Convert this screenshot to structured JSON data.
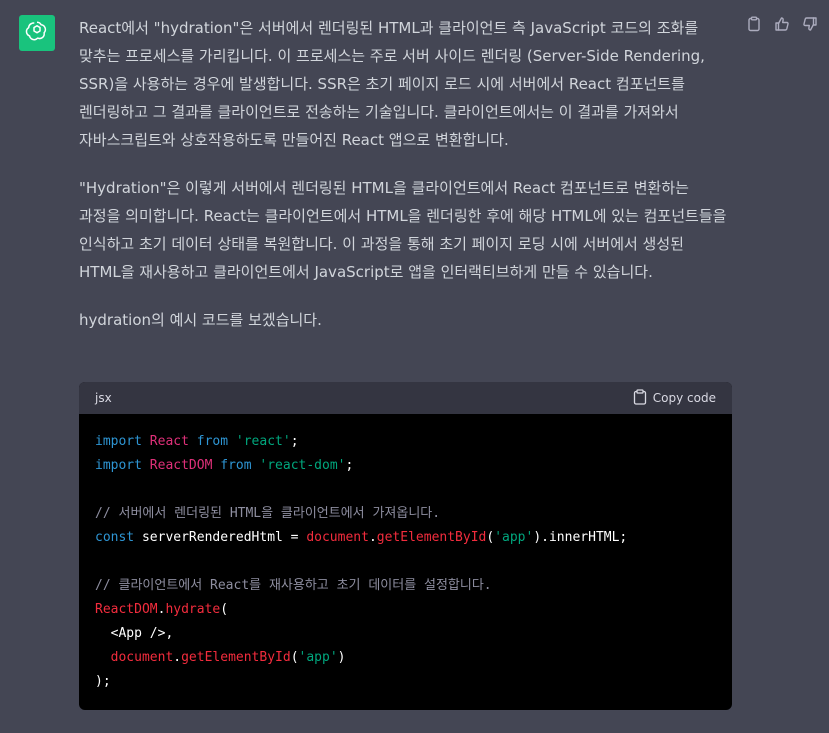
{
  "message": {
    "paragraphs": [
      "React에서 \"hydration\"은 서버에서 렌더링된 HTML과 클라이언트 측 JavaScript 코드의 조화를 맞추는 프로세스를 가리킵니다. 이 프로세스는 주로 서버 사이드 렌더링 (Server-Side Rendering, SSR)을 사용하는 경우에 발생합니다. SSR은 초기 페이지 로드 시에 서버에서 React 컴포넌트를 렌더링하고 그 결과를 클라이언트로 전송하는 기술입니다. 클라이언트에서는 이 결과를 가져와서 자바스크립트와 상호작용하도록 만들어진 React 앱으로 변환합니다.",
      "\"Hydration\"은 이렇게 서버에서 렌더링된 HTML을 클라이언트에서 React 컴포넌트로 변환하는 과정을 의미합니다. React는 클라이언트에서 HTML을 렌더링한 후에 해당 HTML에 있는 컴포넌트들을 인식하고 초기 데이터 상태를 복원합니다. 이 과정을 통해 초기 페이지 로딩 시에 서버에서 생성된 HTML을 재사용하고 클라이언트에서 JavaScript로 앱을 인터랙티브하게 만들 수 있습니다.",
      "hydration의 예시 코드를 보겠습니다."
    ]
  },
  "code": {
    "language": "jsx",
    "copy_label": "Copy code",
    "line1": {
      "t1": "import",
      "t2": " ",
      "t3": "React",
      "t4": " ",
      "t5": "from",
      "t6": " ",
      "t7": "'react'",
      "t8": ";"
    },
    "line2": {
      "t1": "import",
      "t2": " ",
      "t3": "ReactDOM",
      "t4": " ",
      "t5": "from",
      "t6": " ",
      "t7": "'react-dom'",
      "t8": ";"
    },
    "line4": {
      "t1": "// 서버에서 렌더링된 HTML을 클라이언트에서 가져옵니다."
    },
    "line5": {
      "t1": "const",
      "t2": " serverRenderedHtml = ",
      "t3": "document",
      "t4": ".",
      "t5": "getElementById",
      "t6": "(",
      "t7": "'app'",
      "t8": ").innerHTML;"
    },
    "line7": {
      "t1": "// 클라이언트에서 React를 재사용하고 초기 데이터를 설정합니다."
    },
    "line8": {
      "t1": "ReactDOM",
      "t2": ".",
      "t3": "hydrate",
      "t4": "("
    },
    "line9": {
      "t1": "  <App />,"
    },
    "line10": {
      "t1": "  ",
      "t2": "document",
      "t3": ".",
      "t4": "getElementById",
      "t5": "(",
      "t6": "'app'",
      "t7": ")"
    },
    "line11": {
      "t1": ");"
    }
  },
  "icons": {
    "avatar": "openai-logo-icon",
    "copy": "clipboard-icon",
    "thumbs_up": "thumbs-up-icon",
    "thumbs_down": "thumbs-down-icon"
  },
  "colors": {
    "background": "#444654",
    "avatar_bg": "#19c37d",
    "code_bg": "#000000",
    "code_header_bg": "#343541",
    "keyword": "#2e95d3",
    "class_name": "#df3079",
    "string": "#00a67d",
    "comment": "#8e8ea0",
    "function": "#f22c3d"
  }
}
